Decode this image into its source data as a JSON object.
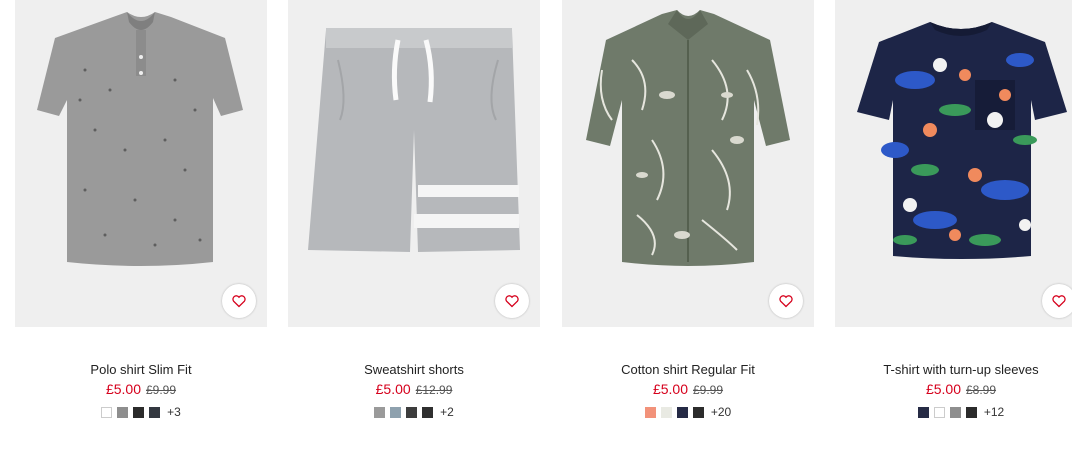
{
  "products": [
    {
      "title": "Polo shirt Slim Fit",
      "price": "£5.00",
      "old_price": "£9.99",
      "swatches": [
        "#ffffff",
        "#8e8e8e",
        "#2b2b2b",
        "#333840"
      ],
      "more": "+3",
      "image": "grey-polo-shirt"
    },
    {
      "title": "Sweatshirt shorts",
      "price": "£5.00",
      "old_price": "£12.99",
      "swatches": [
        "#9a9a9a",
        "#8ea1ae",
        "#3d3d3d",
        "#2f2f2f"
      ],
      "more": "+2",
      "image": "grey-sweat-shorts"
    },
    {
      "title": "Cotton shirt Regular Fit",
      "price": "£5.00",
      "old_price": "£9.99",
      "swatches": [
        "#f2927a",
        "#e9eae3",
        "#252a45",
        "#2c2c2c"
      ],
      "more": "+20",
      "image": "khaki-printed-shirt"
    },
    {
      "title": "T-shirt with turn-up sleeves",
      "price": "£5.00",
      "old_price": "£8.99",
      "swatches": [
        "#262b45",
        "#ffffff",
        "#8e8e8e",
        "#2b2b2b"
      ],
      "more": "+12",
      "image": "navy-floral-tshirt"
    }
  ],
  "icons": {
    "favourite": "heart-outline-icon"
  },
  "colors": {
    "sale": "#d6001c",
    "heart": "#d6001c"
  }
}
